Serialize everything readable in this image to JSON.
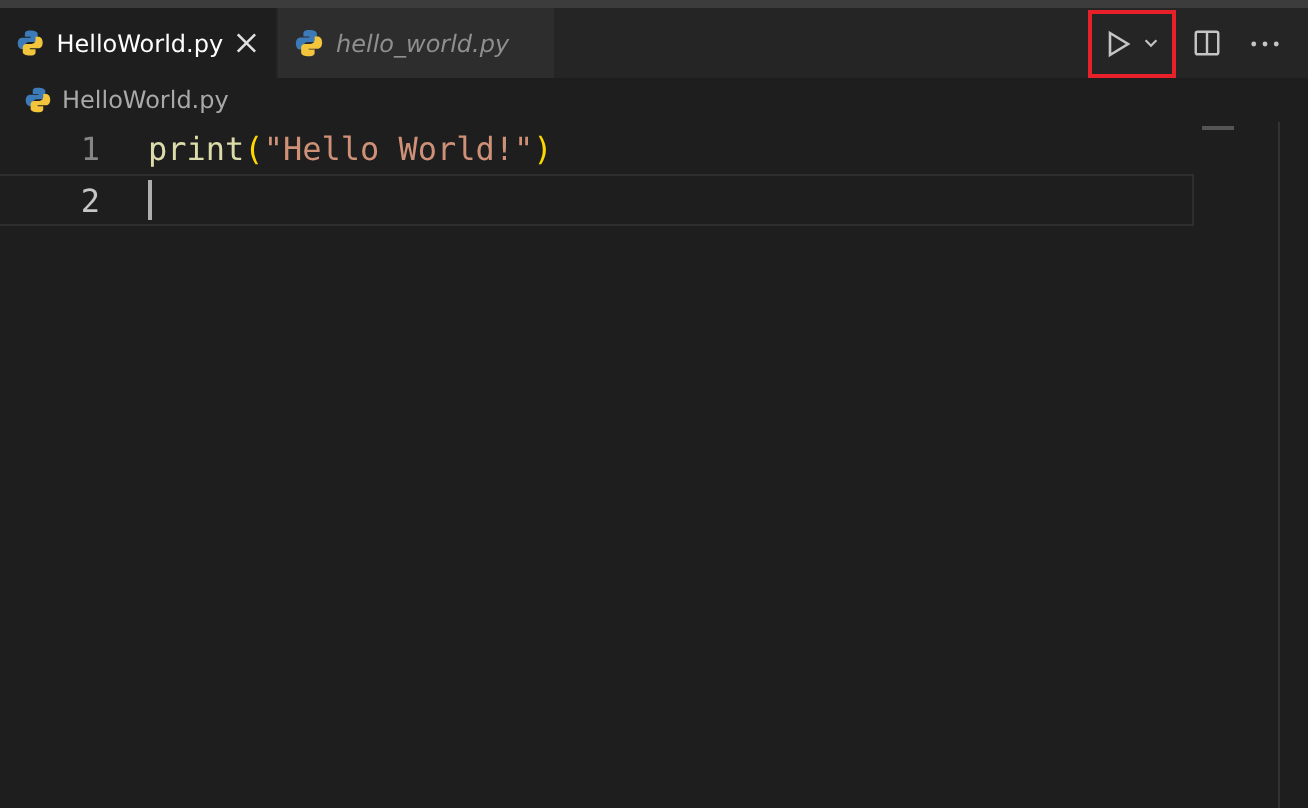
{
  "tabs": [
    {
      "label": "HelloWorld.py",
      "selected": true,
      "preview": false,
      "closable": true
    },
    {
      "label": "hello_world.py",
      "selected": false,
      "preview": true,
      "closable": false
    }
  ],
  "toolbar": {
    "run_highlighted": true
  },
  "breadcrumb": "HelloWorld.py",
  "lines": [
    {
      "number": "1",
      "active": false,
      "tokens": [
        {
          "kind": "function",
          "text": "print"
        },
        {
          "kind": "bracket",
          "text": "("
        },
        {
          "kind": "string",
          "text": "\"Hello World!\""
        },
        {
          "kind": "bracket",
          "text": ")"
        }
      ]
    },
    {
      "number": "2",
      "active": true
    }
  ]
}
